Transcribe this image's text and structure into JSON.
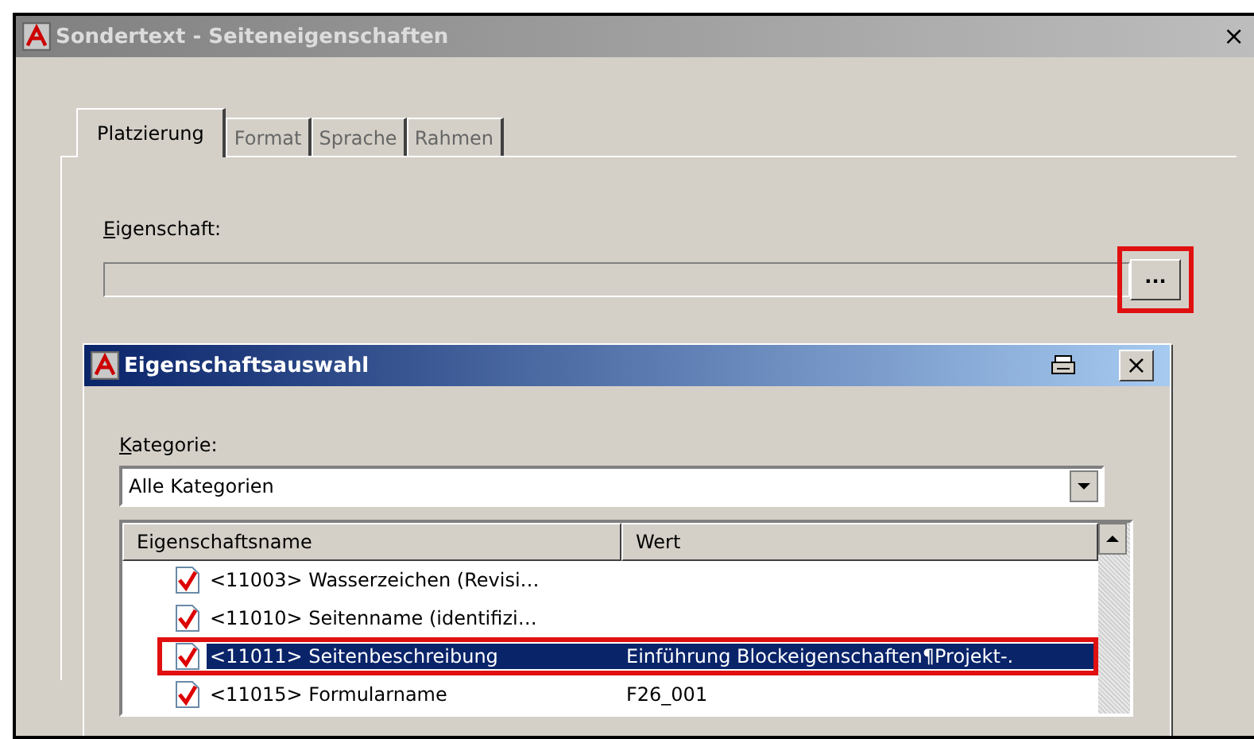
{
  "window": {
    "title": "Sondertext - Seiteneigenschaften",
    "close": "×"
  },
  "tabs": [
    {
      "label": "Platzierung",
      "selected": true
    },
    {
      "label": "Format",
      "selected": false
    },
    {
      "label": "Sprache",
      "selected": false
    },
    {
      "label": "Rahmen",
      "selected": false
    }
  ],
  "property_field": {
    "label": "Eigenschaft:",
    "browse_button": "...",
    "highlighted": true
  },
  "dialog": {
    "title": "Eigenschaftsauswahl",
    "close": "×",
    "category": {
      "label": "Kategorie:",
      "value": "Alle Kategorien"
    },
    "table": {
      "columns": [
        "Eigenschaftsname",
        "Wert"
      ],
      "rows": [
        {
          "name": "<11003> Wasserzeichen (Revisi…",
          "value": "",
          "checked": true,
          "selected": false,
          "highlighted": false
        },
        {
          "name": "<11010> Seitenname (identifizi…",
          "value": "",
          "checked": true,
          "selected": false,
          "highlighted": false
        },
        {
          "name": "<11011> Seitenbeschreibung",
          "value": "Einführung Blockeigenschaften¶Projekt-.",
          "checked": true,
          "selected": true,
          "highlighted": true
        },
        {
          "name": "<11015> Formularname",
          "value": "F26_001",
          "checked": true,
          "selected": false,
          "highlighted": false
        }
      ]
    }
  }
}
